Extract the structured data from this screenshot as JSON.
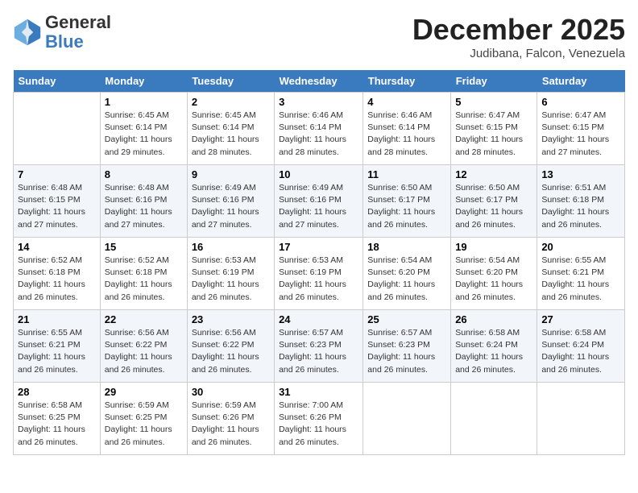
{
  "header": {
    "logo_general": "General",
    "logo_blue": "Blue",
    "month": "December 2025",
    "location": "Judibana, Falcon, Venezuela"
  },
  "weekdays": [
    "Sunday",
    "Monday",
    "Tuesday",
    "Wednesday",
    "Thursday",
    "Friday",
    "Saturday"
  ],
  "weeks": [
    [
      {
        "day": "",
        "info": ""
      },
      {
        "day": "1",
        "info": "Sunrise: 6:45 AM\nSunset: 6:14 PM\nDaylight: 11 hours\nand 29 minutes."
      },
      {
        "day": "2",
        "info": "Sunrise: 6:45 AM\nSunset: 6:14 PM\nDaylight: 11 hours\nand 28 minutes."
      },
      {
        "day": "3",
        "info": "Sunrise: 6:46 AM\nSunset: 6:14 PM\nDaylight: 11 hours\nand 28 minutes."
      },
      {
        "day": "4",
        "info": "Sunrise: 6:46 AM\nSunset: 6:14 PM\nDaylight: 11 hours\nand 28 minutes."
      },
      {
        "day": "5",
        "info": "Sunrise: 6:47 AM\nSunset: 6:15 PM\nDaylight: 11 hours\nand 28 minutes."
      },
      {
        "day": "6",
        "info": "Sunrise: 6:47 AM\nSunset: 6:15 PM\nDaylight: 11 hours\nand 27 minutes."
      }
    ],
    [
      {
        "day": "7",
        "info": "Sunrise: 6:48 AM\nSunset: 6:15 PM\nDaylight: 11 hours\nand 27 minutes."
      },
      {
        "day": "8",
        "info": "Sunrise: 6:48 AM\nSunset: 6:16 PM\nDaylight: 11 hours\nand 27 minutes."
      },
      {
        "day": "9",
        "info": "Sunrise: 6:49 AM\nSunset: 6:16 PM\nDaylight: 11 hours\nand 27 minutes."
      },
      {
        "day": "10",
        "info": "Sunrise: 6:49 AM\nSunset: 6:16 PM\nDaylight: 11 hours\nand 27 minutes."
      },
      {
        "day": "11",
        "info": "Sunrise: 6:50 AM\nSunset: 6:17 PM\nDaylight: 11 hours\nand 26 minutes."
      },
      {
        "day": "12",
        "info": "Sunrise: 6:50 AM\nSunset: 6:17 PM\nDaylight: 11 hours\nand 26 minutes."
      },
      {
        "day": "13",
        "info": "Sunrise: 6:51 AM\nSunset: 6:18 PM\nDaylight: 11 hours\nand 26 minutes."
      }
    ],
    [
      {
        "day": "14",
        "info": "Sunrise: 6:52 AM\nSunset: 6:18 PM\nDaylight: 11 hours\nand 26 minutes."
      },
      {
        "day": "15",
        "info": "Sunrise: 6:52 AM\nSunset: 6:18 PM\nDaylight: 11 hours\nand 26 minutes."
      },
      {
        "day": "16",
        "info": "Sunrise: 6:53 AM\nSunset: 6:19 PM\nDaylight: 11 hours\nand 26 minutes."
      },
      {
        "day": "17",
        "info": "Sunrise: 6:53 AM\nSunset: 6:19 PM\nDaylight: 11 hours\nand 26 minutes."
      },
      {
        "day": "18",
        "info": "Sunrise: 6:54 AM\nSunset: 6:20 PM\nDaylight: 11 hours\nand 26 minutes."
      },
      {
        "day": "19",
        "info": "Sunrise: 6:54 AM\nSunset: 6:20 PM\nDaylight: 11 hours\nand 26 minutes."
      },
      {
        "day": "20",
        "info": "Sunrise: 6:55 AM\nSunset: 6:21 PM\nDaylight: 11 hours\nand 26 minutes."
      }
    ],
    [
      {
        "day": "21",
        "info": "Sunrise: 6:55 AM\nSunset: 6:21 PM\nDaylight: 11 hours\nand 26 minutes."
      },
      {
        "day": "22",
        "info": "Sunrise: 6:56 AM\nSunset: 6:22 PM\nDaylight: 11 hours\nand 26 minutes."
      },
      {
        "day": "23",
        "info": "Sunrise: 6:56 AM\nSunset: 6:22 PM\nDaylight: 11 hours\nand 26 minutes."
      },
      {
        "day": "24",
        "info": "Sunrise: 6:57 AM\nSunset: 6:23 PM\nDaylight: 11 hours\nand 26 minutes."
      },
      {
        "day": "25",
        "info": "Sunrise: 6:57 AM\nSunset: 6:23 PM\nDaylight: 11 hours\nand 26 minutes."
      },
      {
        "day": "26",
        "info": "Sunrise: 6:58 AM\nSunset: 6:24 PM\nDaylight: 11 hours\nand 26 minutes."
      },
      {
        "day": "27",
        "info": "Sunrise: 6:58 AM\nSunset: 6:24 PM\nDaylight: 11 hours\nand 26 minutes."
      }
    ],
    [
      {
        "day": "28",
        "info": "Sunrise: 6:58 AM\nSunset: 6:25 PM\nDaylight: 11 hours\nand 26 minutes."
      },
      {
        "day": "29",
        "info": "Sunrise: 6:59 AM\nSunset: 6:25 PM\nDaylight: 11 hours\nand 26 minutes."
      },
      {
        "day": "30",
        "info": "Sunrise: 6:59 AM\nSunset: 6:26 PM\nDaylight: 11 hours\nand 26 minutes."
      },
      {
        "day": "31",
        "info": "Sunrise: 7:00 AM\nSunset: 6:26 PM\nDaylight: 11 hours\nand 26 minutes."
      },
      {
        "day": "",
        "info": ""
      },
      {
        "day": "",
        "info": ""
      },
      {
        "day": "",
        "info": ""
      }
    ]
  ]
}
